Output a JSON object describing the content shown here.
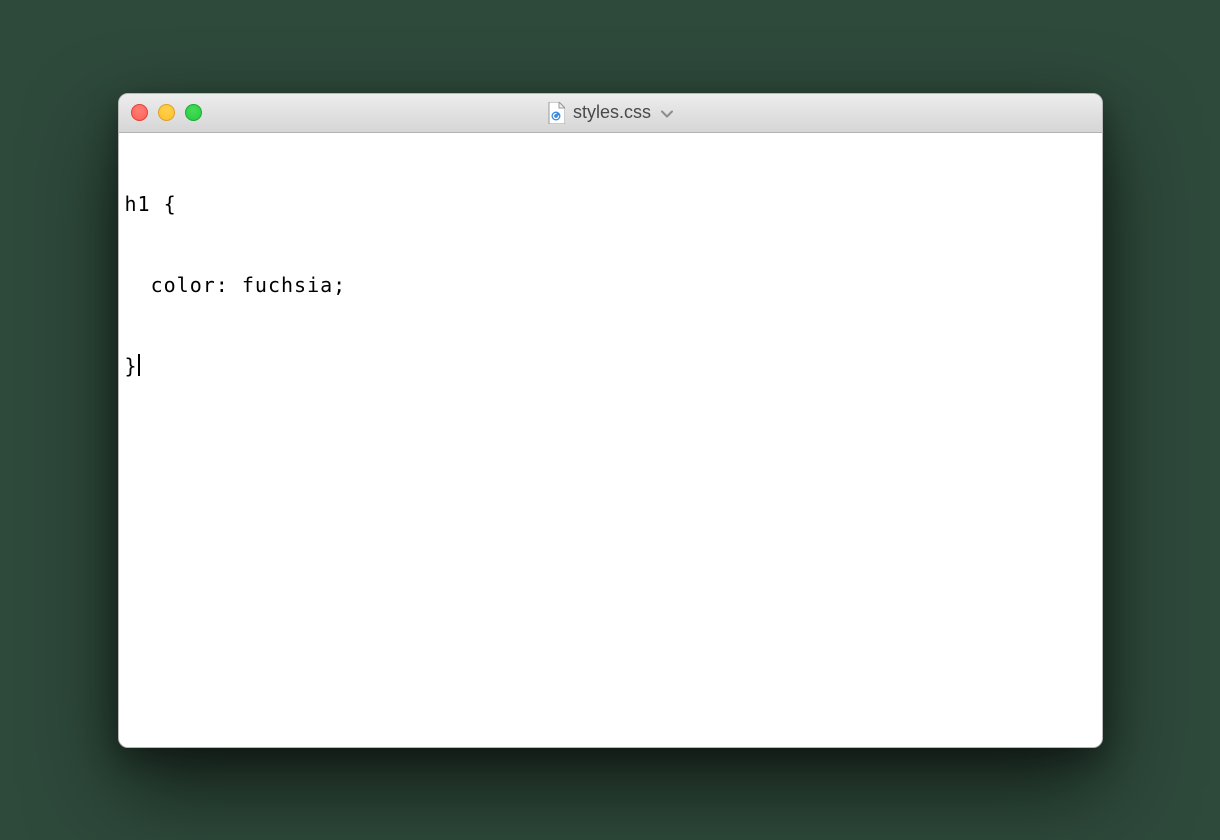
{
  "window": {
    "title": "styles.css",
    "file_icon": "css-file-icon",
    "traffic_lights": {
      "close": "close",
      "minimize": "minimize",
      "zoom": "zoom"
    }
  },
  "editor": {
    "lines": [
      "h1 {",
      "  color: fuchsia;",
      "}"
    ],
    "cursor_after_line": 2
  }
}
